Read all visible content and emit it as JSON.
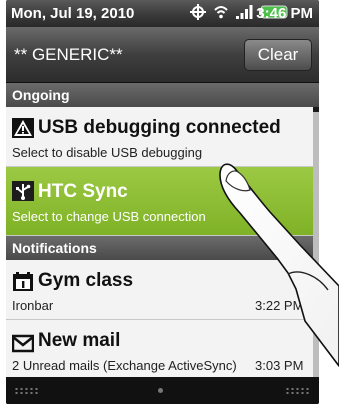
{
  "status_bar": {
    "date": "Mon, Jul 19, 2010",
    "time": "3:46 PM",
    "icons": [
      "gps-icon",
      "wifi-icon",
      "signal-icon",
      "battery-icon"
    ]
  },
  "header": {
    "carrier": "** GENERIC**",
    "clear_label": "Clear"
  },
  "sections": {
    "ongoing": "Ongoing",
    "notifications": "Notifications"
  },
  "ongoing_items": [
    {
      "title": "USB debugging connected",
      "subtitle": "Select to disable USB debugging",
      "icon": "warning-icon"
    },
    {
      "title": "HTC Sync",
      "subtitle": "Select to change USB connection",
      "icon": "usb-icon"
    }
  ],
  "notification_items": [
    {
      "title": "Gym class",
      "subtitle": "Ironbar",
      "time": "3:22 PM",
      "icon": "calendar-icon"
    },
    {
      "title": "New mail",
      "subtitle": "2 Unread mails (Exchange ActiveSync)",
      "time": "3:03 PM",
      "icon": "mail-icon"
    }
  ],
  "colors": {
    "active_row": "#8cbf30",
    "section_bg": "#5a5a5a"
  }
}
